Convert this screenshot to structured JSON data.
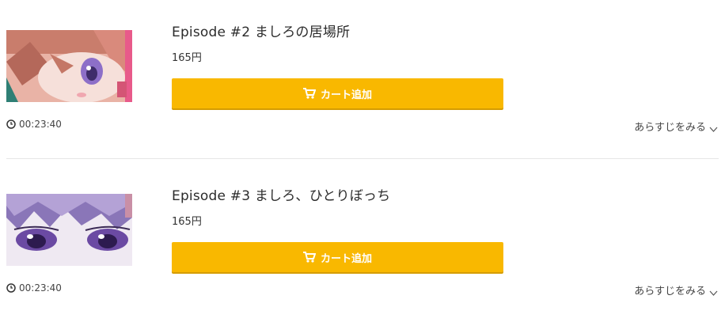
{
  "episodes": [
    {
      "title": "Episode #2 ましろの居場所",
      "price": "165円",
      "cart_label": "カート追加",
      "duration": "00:23:40",
      "synopsis_label": "あらすじをみる"
    },
    {
      "title": "Episode #3 ましろ、ひとりぼっち",
      "price": "165円",
      "cart_label": "カート追加",
      "duration": "00:23:40",
      "synopsis_label": "あらすじをみる"
    }
  ],
  "colors": {
    "cart_button": "#f9b800",
    "divider": "#e6e6e6"
  }
}
